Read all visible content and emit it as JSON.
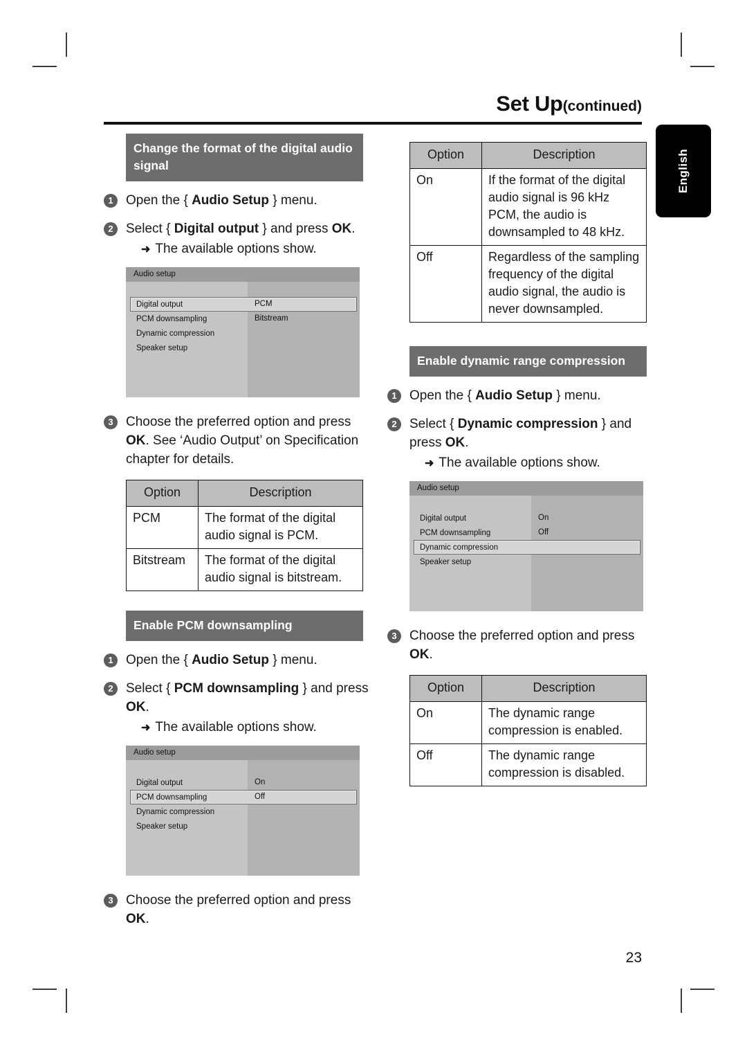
{
  "page": {
    "title_main": "Set Up",
    "title_suffix": "(continued)",
    "number": "23",
    "language_tab": "English"
  },
  "left_column": {
    "section1": {
      "heading": "Change the format of the digital audio signal",
      "steps": [
        {
          "num": "1",
          "text_html": "Open the { <b>Audio Setup</b> } menu."
        },
        {
          "num": "2",
          "text_html": "Select { <b>Digital output</b> } and press <b>OK</b>."
        }
      ],
      "substep": "The available options show.",
      "osd": {
        "title": "Audio setup",
        "menu_items": [
          "Digital output",
          "PCM downsampling",
          "Dynamic compression",
          "Speaker setup"
        ],
        "selected_index": 0,
        "values": [
          "PCM",
          "Bitstream"
        ]
      },
      "step3": {
        "num": "3",
        "text_html": "Choose the preferred option and press <b>OK</b>. See ‘Audio Output’ on Specification chapter for details."
      },
      "table": {
        "headers": [
          "Option",
          "Description"
        ],
        "rows": [
          [
            "PCM",
            "The format of the digital audio signal is PCM."
          ],
          [
            "Bitstream",
            "The format of the digital audio signal is bitstream."
          ]
        ]
      }
    },
    "section2": {
      "heading": "Enable PCM downsampling",
      "steps": [
        {
          "num": "1",
          "text_html": "Open the { <b>Audio Setup</b> } menu."
        },
        {
          "num": "2",
          "text_html": "Select { <b>PCM downsampling</b> } and press <b>OK</b>."
        }
      ],
      "substep": "The available options show.",
      "osd": {
        "title": "Audio setup",
        "menu_items": [
          "Digital output",
          "PCM downsampling",
          "Dynamic compression",
          "Speaker setup"
        ],
        "selected_index": 1,
        "values": [
          "On",
          "Off"
        ]
      },
      "step3": {
        "num": "3",
        "text_html": "Choose the preferred option and press <b>OK</b>."
      }
    }
  },
  "right_column": {
    "table_top": {
      "headers": [
        "Option",
        "Description"
      ],
      "rows": [
        [
          "On",
          "If the format of the digital audio signal is 96 kHz PCM, the audio is downsampled to 48 kHz."
        ],
        [
          "Off",
          "Regardless of the sampling frequency of the digital audio signal, the audio is never downsampled."
        ]
      ]
    },
    "section3": {
      "heading": "Enable dynamic range compression",
      "steps": [
        {
          "num": "1",
          "text_html": "Open the { <b>Audio Setup</b> } menu."
        },
        {
          "num": "2",
          "text_html": "Select { <b>Dynamic compression</b> } and press <b>OK</b>."
        }
      ],
      "substep": "The available options show.",
      "osd": {
        "title": "Audio setup",
        "menu_items": [
          "Digital output",
          "PCM downsampling",
          "Dynamic compression",
          "Speaker setup"
        ],
        "selected_index": 2,
        "values": [
          "On",
          "Off"
        ]
      },
      "step3": {
        "num": "3",
        "text_html": "Choose the preferred option and press <b>OK</b>."
      },
      "table": {
        "headers": [
          "Option",
          "Description"
        ],
        "rows": [
          [
            "On",
            "The dynamic range compression is enabled."
          ],
          [
            "Off",
            "The dynamic range compression is disabled."
          ]
        ]
      }
    }
  },
  "icons": {
    "arrow": "➜"
  },
  "colors": {
    "section_bar": "#6d6d6d",
    "table_header": "#bdbdbd",
    "osd_background": "#b4b4b4",
    "lang_tab": "#000000"
  }
}
